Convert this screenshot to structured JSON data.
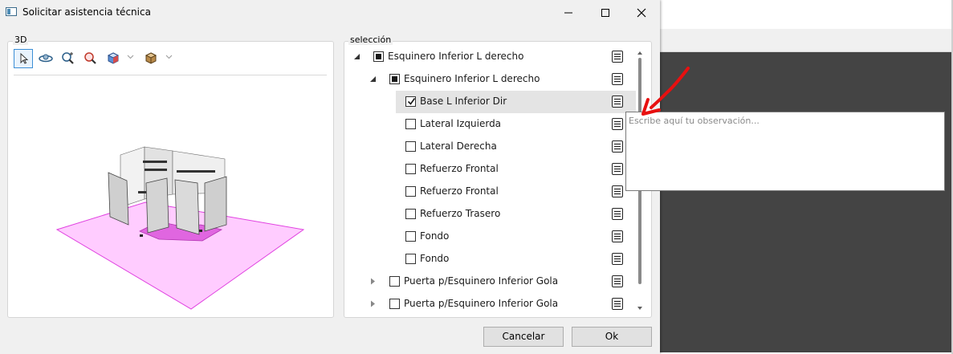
{
  "dialog": {
    "title": "Solicitar asistencia técnica",
    "controls": [
      "minimize",
      "maximize",
      "close"
    ]
  },
  "viewer": {
    "group_label": "3D",
    "tools": [
      {
        "name": "select-pointer-icon",
        "active": true
      },
      {
        "name": "orbit-icon",
        "active": false
      },
      {
        "name": "zoom-extents-icon",
        "active": false
      },
      {
        "name": "zoom-icon",
        "active": false
      },
      {
        "name": "view-cube-icon",
        "active": false,
        "has_dropdown": true
      },
      {
        "name": "render-box-icon",
        "active": false,
        "has_dropdown": true
      }
    ],
    "floor_color": "#ffccff",
    "floor_border": "#e040e0"
  },
  "selection": {
    "group_label": "selección",
    "items": [
      {
        "label": "Esquinero Inferior L derecho",
        "level": 0,
        "expander": "expanded",
        "state": "partial"
      },
      {
        "label": "Esquinero Inferior L derecho",
        "level": 1,
        "expander": "expanded",
        "state": "partial"
      },
      {
        "label": "Base L Inferior Dir",
        "level": 2,
        "expander": "none",
        "state": "checked",
        "selected": true
      },
      {
        "label": "Lateral Izquierda",
        "level": 2,
        "expander": "none",
        "state": "unchecked"
      },
      {
        "label": "Lateral Derecha",
        "level": 2,
        "expander": "none",
        "state": "unchecked"
      },
      {
        "label": "Refuerzo Frontal",
        "level": 2,
        "expander": "none",
        "state": "unchecked"
      },
      {
        "label": "Refuerzo Frontal",
        "level": 2,
        "expander": "none",
        "state": "unchecked"
      },
      {
        "label": "Refuerzo Trasero",
        "level": 2,
        "expander": "none",
        "state": "unchecked"
      },
      {
        "label": "Fondo",
        "level": 2,
        "expander": "none",
        "state": "unchecked"
      },
      {
        "label": "Fondo",
        "level": 2,
        "expander": "none",
        "state": "unchecked"
      },
      {
        "label": "Puerta p/Esquinero Inferior Gola",
        "level": 1,
        "expander": "collapsed",
        "state": "unchecked"
      },
      {
        "label": "Puerta p/Esquinero Inferior Gola",
        "level": 1,
        "expander": "collapsed",
        "state": "unchecked"
      }
    ],
    "note_icon": "notes-icon"
  },
  "observation": {
    "placeholder": "Escribe aquí tu observación...",
    "value": ""
  },
  "buttons": {
    "cancel": "Cancelar",
    "ok": "Ok"
  },
  "colors": {
    "annotation_arrow": "#e81010",
    "selected_row": "#e4e4e4",
    "background_app": "#444444"
  }
}
